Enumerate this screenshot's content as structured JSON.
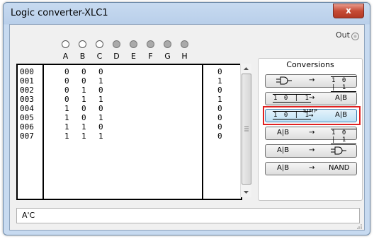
{
  "window": {
    "title": "Logic converter-XLC1",
    "close_glyph": "x"
  },
  "out": {
    "label": "Out"
  },
  "inputs": [
    {
      "letter": "A",
      "enabled": true
    },
    {
      "letter": "B",
      "enabled": true
    },
    {
      "letter": "C",
      "enabled": true
    },
    {
      "letter": "D",
      "enabled": false
    },
    {
      "letter": "E",
      "enabled": false
    },
    {
      "letter": "F",
      "enabled": false
    },
    {
      "letter": "G",
      "enabled": false
    },
    {
      "letter": "H",
      "enabled": false
    }
  ],
  "truth_table": {
    "rows": [
      {
        "index": "000",
        "a": "0",
        "b": "0",
        "c": "0",
        "out": "0"
      },
      {
        "index": "001",
        "a": "0",
        "b": "0",
        "c": "1",
        "out": "1"
      },
      {
        "index": "002",
        "a": "0",
        "b": "1",
        "c": "0",
        "out": "0"
      },
      {
        "index": "003",
        "a": "0",
        "b": "1",
        "c": "1",
        "out": "1"
      },
      {
        "index": "004",
        "a": "1",
        "b": "0",
        "c": "0",
        "out": "0"
      },
      {
        "index": "005",
        "a": "1",
        "b": "0",
        "c": "1",
        "out": "0"
      },
      {
        "index": "006",
        "a": "1",
        "b": "1",
        "c": "0",
        "out": "0"
      },
      {
        "index": "007",
        "a": "1",
        "b": "1",
        "c": "1",
        "out": "0"
      }
    ]
  },
  "conversions": {
    "title": "Conversions",
    "arrow": "→",
    "buttons": [
      {
        "left": "⊐▷",
        "mid": "→",
        "right": "1 0 | 1"
      },
      {
        "left": "1 0 | 1",
        "mid": "→",
        "right": "A|B"
      },
      {
        "left": "1 0 | 1",
        "mid": "SIMP",
        "right": "A|B",
        "selected": true
      },
      {
        "left": "A|B",
        "mid": "→",
        "right": "1 0 | 1"
      },
      {
        "left": "A|B",
        "mid": "→",
        "right": "⊐▷"
      },
      {
        "left": "A|B",
        "mid": "→",
        "right": "NAND"
      }
    ]
  },
  "result": {
    "expression": "A'C"
  },
  "colors": {
    "highlight": "#e02020"
  }
}
